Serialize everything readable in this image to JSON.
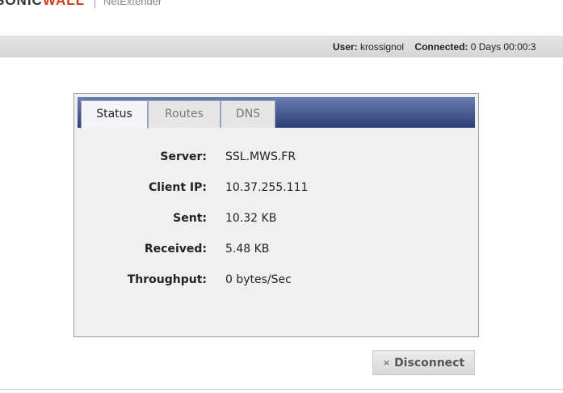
{
  "brand": {
    "logo_text": "SONICWALL",
    "product": "NetExtender"
  },
  "topbar": {
    "user_label": "User:",
    "user_value": "krossignol",
    "connected_label": "Connected:",
    "connected_value": "0 Days 00:00:3"
  },
  "tabs": [
    {
      "label": "Status",
      "active": true
    },
    {
      "label": "Routes",
      "active": false
    },
    {
      "label": "DNS",
      "active": false
    }
  ],
  "status": {
    "server_label": "Server:",
    "server_value": "SSL.MWS.FR",
    "client_ip_label": "Client IP:",
    "client_ip_value": "10.37.255.111",
    "sent_label": "Sent:",
    "sent_value": "10.32 KB",
    "received_label": "Received:",
    "received_value": "5.48 KB",
    "throughput_label": "Throughput:",
    "throughput_value": "0 bytes/Sec"
  },
  "actions": {
    "disconnect_icon": "×",
    "disconnect_label": "Disconnect"
  }
}
